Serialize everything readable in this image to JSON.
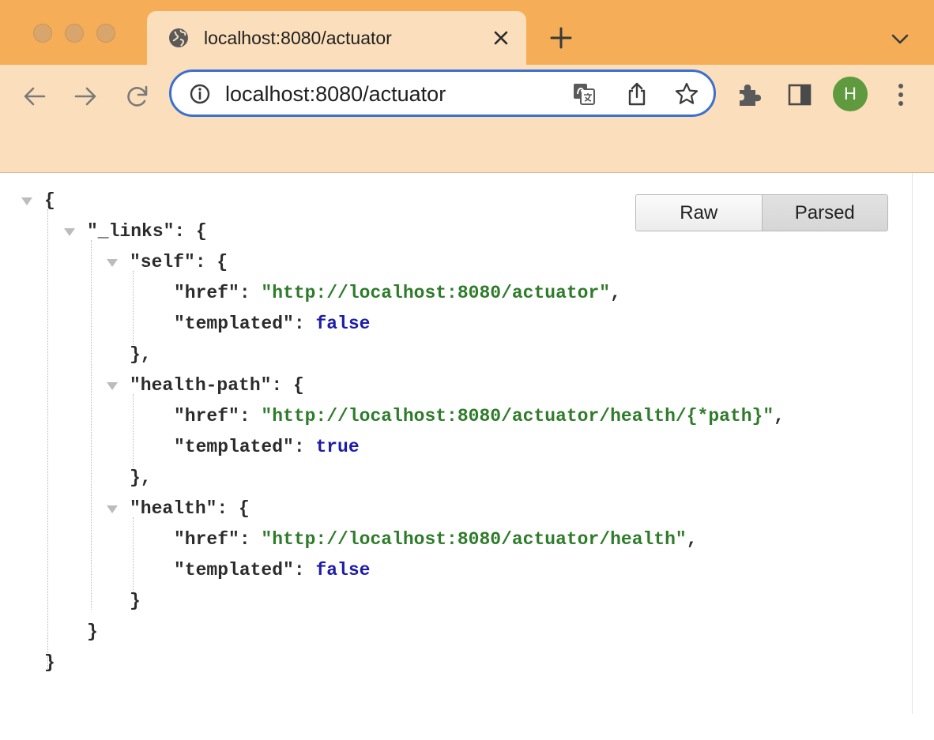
{
  "tab": {
    "title": "localhost:8080/actuator"
  },
  "omnibox": {
    "url": "localhost:8080/actuator"
  },
  "profile": {
    "initial": "H",
    "color": "#5f9a3e"
  },
  "colors": {
    "frame": "#f5ae57",
    "toolbar": "#fbdfbc",
    "omnibox_border": "#3b6fd0",
    "json_string": "#2e7b2a",
    "json_bool": "#1c1ca8"
  },
  "viewer": {
    "raw_label": "Raw",
    "parsed_label": "Parsed"
  },
  "json": {
    "open": "{",
    "close": "}",
    "links_key": "\"_links\": {",
    "links_close": "}",
    "self": {
      "key": "\"self\": {",
      "href_key": "\"href\": ",
      "href_value": "\"http://localhost:8080/actuator\"",
      "comma": ",",
      "templated_key": "\"templated\": ",
      "templated_value": "false",
      "close": "},"
    },
    "health_path": {
      "key": "\"health-path\": {",
      "href_key": "\"href\": ",
      "href_value": "\"http://localhost:8080/actuator/health/{*path}\"",
      "comma": ",",
      "templated_key": "\"templated\": ",
      "templated_value": "true",
      "close": "},"
    },
    "health": {
      "key": "\"health\": {",
      "href_key": "\"href\": ",
      "href_value": "\"http://localhost:8080/actuator/health\"",
      "comma": ",",
      "templated_key": "\"templated\": ",
      "templated_value": "false",
      "close": "}"
    }
  }
}
